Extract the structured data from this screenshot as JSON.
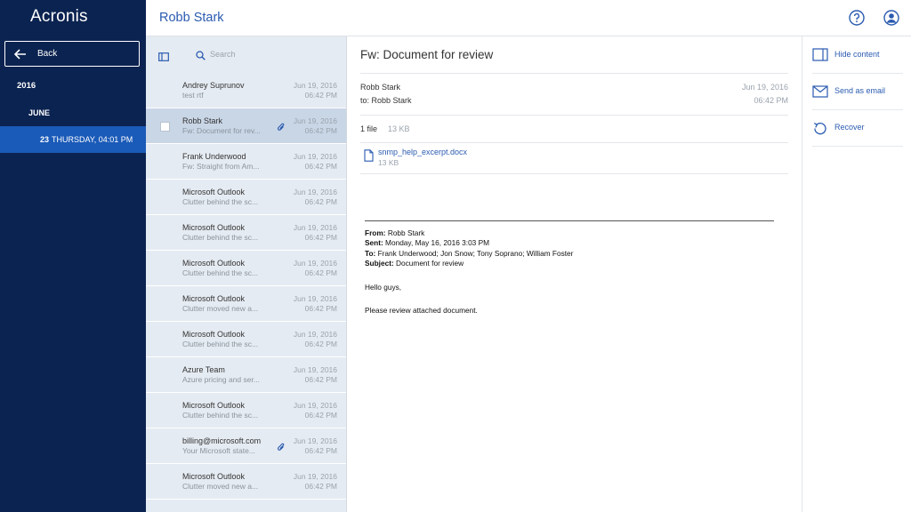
{
  "sidebar": {
    "logo": "Acronis",
    "back_label": "Back",
    "year": "2016",
    "month": "JUNE",
    "day_num": "23",
    "day_rest": "THURSDAY, 04:01 PM"
  },
  "header": {
    "title": "Robb Stark"
  },
  "list": {
    "search_placeholder": "Search",
    "messages": [
      {
        "sender": "Andrey Suprunov",
        "snippet": "test rtf",
        "date": "Jun 19, 2016",
        "time": "06:42 PM"
      },
      {
        "sender": "Robb Stark",
        "snippet": "Fw: Document for rev...",
        "date": "Jun 19, 2016",
        "time": "06:42 PM"
      },
      {
        "sender": "Frank Underwood",
        "snippet": "Fw: Straight from Am...",
        "date": "Jun 19, 2016",
        "time": "06:42 PM"
      },
      {
        "sender": "Microsoft Outlook",
        "snippet": "Clutter behind the sc...",
        "date": "Jun 19, 2016",
        "time": "06:42 PM"
      },
      {
        "sender": "Microsoft Outlook",
        "snippet": "Clutter behind the sc...",
        "date": "Jun 19, 2016",
        "time": "06:42 PM"
      },
      {
        "sender": "Microsoft Outlook",
        "snippet": "Clutter behind the sc...",
        "date": "Jun 19, 2016",
        "time": "06:42 PM"
      },
      {
        "sender": "Microsoft Outlook",
        "snippet": "Clutter moved new a...",
        "date": "Jun 19, 2016",
        "time": "06:42 PM"
      },
      {
        "sender": "Microsoft Outlook",
        "snippet": "Clutter behind the sc...",
        "date": "Jun 19, 2016",
        "time": "06:42 PM"
      },
      {
        "sender": "Azure Team",
        "snippet": "Azure pricing and ser...",
        "date": "Jun 19, 2016",
        "time": "06:42 PM"
      },
      {
        "sender": "Microsoft Outlook",
        "snippet": "Clutter behind the sc...",
        "date": "Jun 19, 2016",
        "time": "06:42 PM"
      },
      {
        "sender": "billing@microsoft.com",
        "snippet": "Your Microsoft state...",
        "date": "Jun 19, 2016",
        "time": "06:42 PM"
      },
      {
        "sender": "Microsoft Outlook",
        "snippet": "Clutter moved new a...",
        "date": "Jun 19, 2016",
        "time": "06:42 PM"
      }
    ]
  },
  "email": {
    "subject": "Fw: Document for review",
    "from": "Robb Stark",
    "to": "to: Robb Stark",
    "date": "Jun 19, 2016",
    "time": "06:42 PM",
    "file_count": "1 file",
    "file_total": "13 KB",
    "attachment_name": "snmp_help_excerpt.docx",
    "attachment_size": "13 KB",
    "fwd_from_label": "From:",
    "fwd_from": " Robb Stark",
    "fwd_sent_label": "Sent:",
    "fwd_sent": " Monday, May 16, 2016 3:03 PM",
    "fwd_to_label": "To:",
    "fwd_to": " Frank Underwood; Jon Snow; Tony Soprano; William Foster",
    "fwd_subject_label": "Subject:",
    "fwd_subject": " Document for review",
    "greeting": "Hello guys,",
    "message": "Please review attached document."
  },
  "actions": {
    "hide_content": "Hide content",
    "send_as_email": "Send as email",
    "recover": "Recover"
  },
  "colors": {
    "sidebar_bg": "#0b2350",
    "selected_nav": "#1a5ab8",
    "accent": "#2a5bb0",
    "list_bg": "#e5ebf2"
  },
  "icons": [
    "arrow-left-icon",
    "help-icon",
    "account-icon",
    "panel-toggle-icon",
    "search-icon",
    "paperclip-icon",
    "document-icon",
    "hide-content-icon",
    "send-email-icon",
    "recover-icon"
  ]
}
